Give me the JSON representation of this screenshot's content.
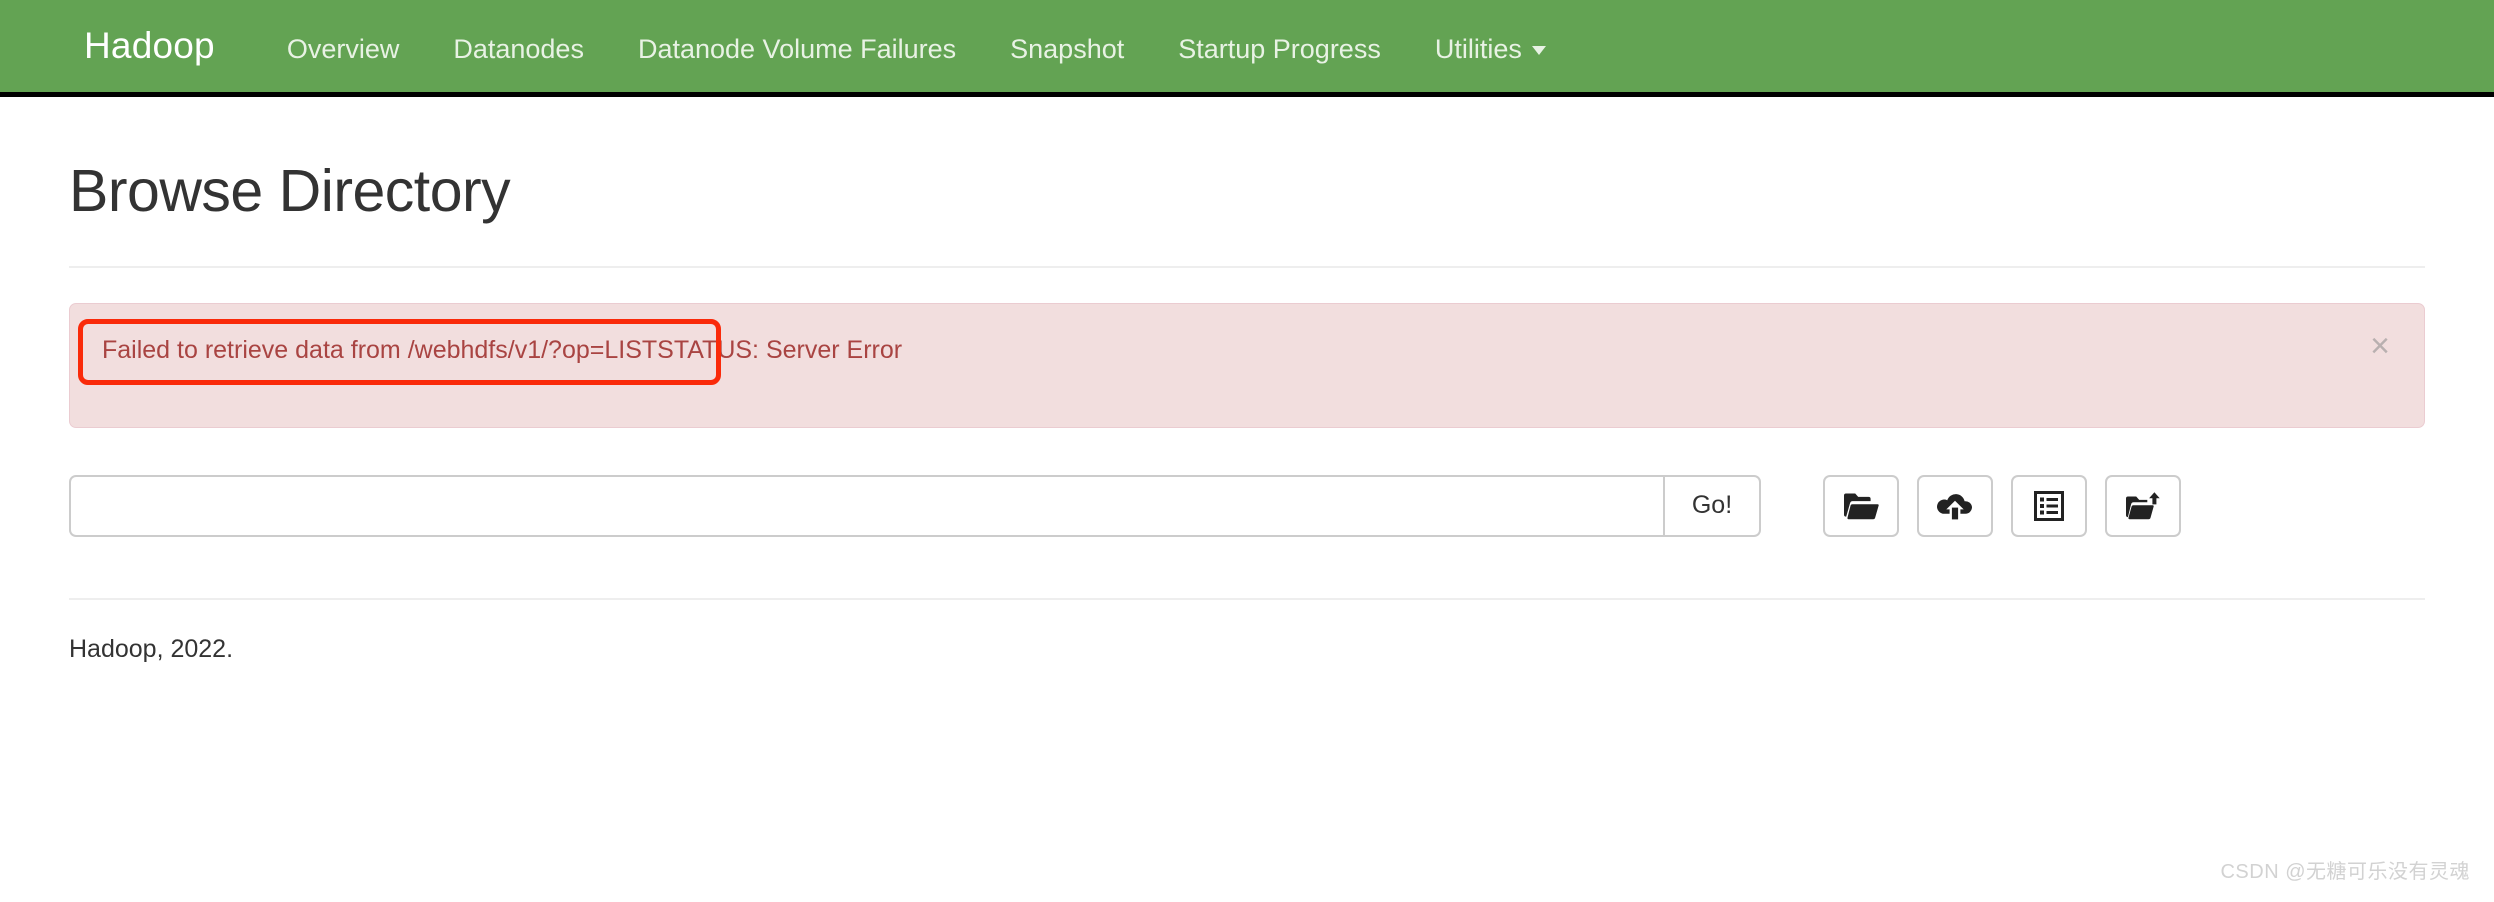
{
  "navbar": {
    "brand": "Hadoop",
    "background_color": "#63a353",
    "items": [
      {
        "label": "Overview",
        "name": "overview"
      },
      {
        "label": "Datanodes",
        "name": "datanodes"
      },
      {
        "label": "Datanode Volume Failures",
        "name": "datanode-volume-failures"
      },
      {
        "label": "Snapshot",
        "name": "snapshot"
      },
      {
        "label": "Startup Progress",
        "name": "startup-progress"
      },
      {
        "label": "Utilities",
        "name": "utilities",
        "has_caret": true
      }
    ]
  },
  "page": {
    "title": "Browse Directory"
  },
  "alert": {
    "message": "Failed to retrieve data from /webhdfs/v1/?op=LISTSTATUS: Server Error",
    "close_label": "×",
    "background_color": "#f2dede",
    "text_color": "#a94442",
    "border_color": "#ebccd1",
    "annotation_color": "#fa2a0a"
  },
  "toolbar": {
    "path_input_value": "",
    "path_input_placeholder": "",
    "go_label": "Go!",
    "icon_buttons": [
      {
        "name": "open-folder-icon",
        "title": "Browse"
      },
      {
        "name": "cloud-upload-icon",
        "title": "Upload Files"
      },
      {
        "name": "list-icon",
        "title": "Cut & Paste"
      },
      {
        "name": "new-directory-icon",
        "title": "Create Directory"
      }
    ]
  },
  "footer": {
    "text": "Hadoop, 2022."
  },
  "watermark": {
    "text": "CSDN @无糖可乐没有灵魂"
  }
}
